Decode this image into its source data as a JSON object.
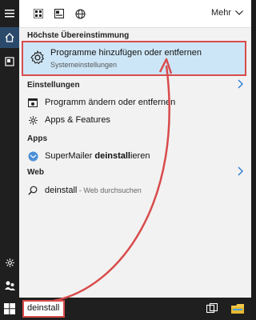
{
  "topbar": {
    "more_label": "Mehr"
  },
  "sections": {
    "best_match": "Höchste Übereinstimmung",
    "settings": "Einstellungen",
    "apps": "Apps",
    "web": "Web"
  },
  "best_match": {
    "title": "Programme hinzufügen oder entfernen",
    "subtitle": "Systemeinstellungen"
  },
  "settings_items": [
    "Programm ändern oder entfernen",
    "Apps & Features"
  ],
  "apps_item": {
    "name": "SuperMailer ",
    "bold_part": "deinstall",
    "suffix": "ieren"
  },
  "web_item": {
    "query": "deinstall",
    "hint": " - Web durchsuchen"
  },
  "search": {
    "value": "deinstall"
  },
  "icons": {
    "rail": [
      "hamburger-menu-icon",
      "home-icon",
      "documents-icon",
      "settings-gear-icon",
      "user-icon"
    ],
    "topbar": [
      "apps-grid-icon",
      "document-icon",
      "globe-icon"
    ],
    "taskbar": [
      "windows-start-icon",
      "task-view-icon",
      "file-explorer-icon"
    ]
  },
  "colors": {
    "highlight": "#cde6f7",
    "annotation_red": "#d94b4b",
    "accent": "#2b7cd3"
  }
}
